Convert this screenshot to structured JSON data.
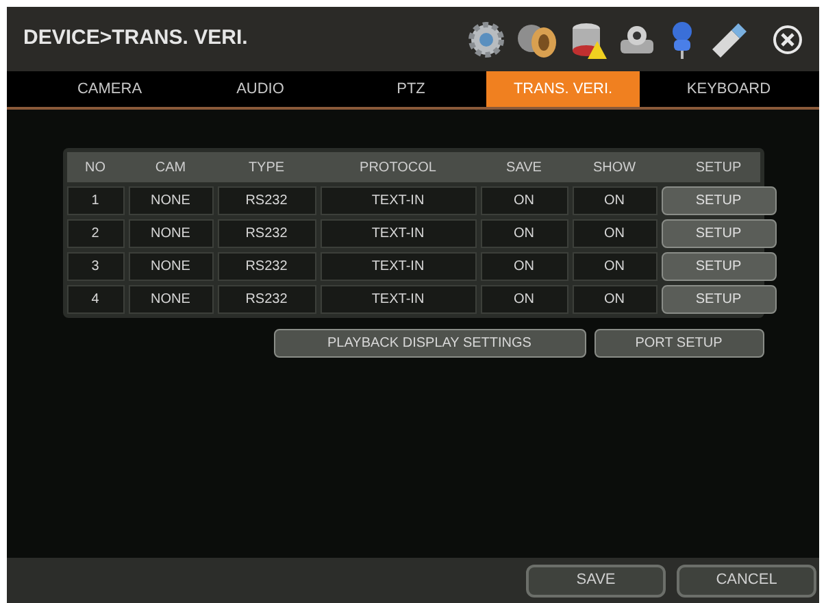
{
  "window": {
    "title": "DEVICE>TRANS. VERI."
  },
  "tabs": [
    {
      "label": "CAMERA",
      "selected": false
    },
    {
      "label": "AUDIO",
      "selected": false
    },
    {
      "label": "PTZ",
      "selected": false
    },
    {
      "label": "TRANS. VERI.",
      "selected": true
    },
    {
      "label": "KEYBOARD",
      "selected": false
    }
  ],
  "table": {
    "columns": [
      "NO",
      "CAM",
      "TYPE",
      "PROTOCOL",
      "SAVE",
      "SHOW",
      "SETUP"
    ],
    "rows": [
      {
        "no": "1",
        "cam": "NONE",
        "type": "RS232",
        "protocol": "TEXT-IN",
        "save": "ON",
        "show": "ON",
        "setup": "SETUP"
      },
      {
        "no": "2",
        "cam": "NONE",
        "type": "RS232",
        "protocol": "TEXT-IN",
        "save": "ON",
        "show": "ON",
        "setup": "SETUP"
      },
      {
        "no": "3",
        "cam": "NONE",
        "type": "RS232",
        "protocol": "TEXT-IN",
        "save": "ON",
        "show": "ON",
        "setup": "SETUP"
      },
      {
        "no": "4",
        "cam": "NONE",
        "type": "RS232",
        "protocol": "TEXT-IN",
        "save": "ON",
        "show": "ON",
        "setup": "SETUP"
      }
    ]
  },
  "actions": [
    "PLAYBACK DISPLAY SETTINGS",
    "PORT SETUP"
  ],
  "footer_buttons": [
    "SAVE",
    "CANCEL"
  ]
}
